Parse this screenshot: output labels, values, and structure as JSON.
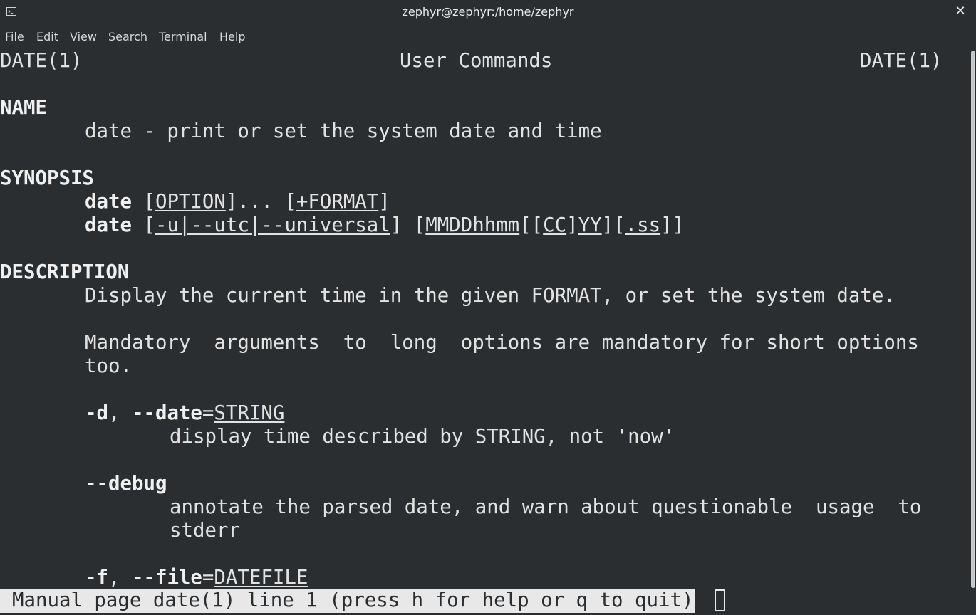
{
  "window": {
    "title": "zephyr@zephyr:/home/zephyr",
    "close_glyph": "✕",
    "app_icon": "terminal-icon"
  },
  "menubar": {
    "items": [
      "File",
      "Edit",
      "View",
      "Search",
      "Terminal",
      "Help"
    ]
  },
  "man": {
    "header_left": "DATE(1)",
    "header_center": "User Commands",
    "header_right": "DATE(1)",
    "name_heading": "NAME",
    "name_text": "date - print or set the system date and time",
    "synopsis_heading": "SYNOPSIS",
    "synopsis_cmd": "date",
    "synopsis1_open": " [",
    "synopsis1_option": "OPTION",
    "synopsis1_mid": "]... [",
    "synopsis1_format": "+FORMAT",
    "synopsis1_close": "]",
    "synopsis2_open": " [",
    "synopsis2_u": "-u|--utc|--universal",
    "synopsis2_mid1": "] [",
    "synopsis2_mmdd": "MMDDhhmm",
    "synopsis2_b1": "[[",
    "synopsis2_cc": "CC",
    "synopsis2_b2": "]",
    "synopsis2_yy": "YY",
    "synopsis2_b3": "][",
    "synopsis2_ss": ".ss",
    "synopsis2_close": "]]",
    "description_heading": "DESCRIPTION",
    "desc_line1": "Display the current time in the given FORMAT, or set the system date.",
    "desc_line2": "Mandatory  arguments  to  long  options are mandatory for short options",
    "desc_line3": "too.",
    "opt_d_short": "-d",
    "opt_d_sep": ", ",
    "opt_d_long": "--date",
    "opt_d_eq": "=",
    "opt_d_arg": "STRING",
    "opt_d_desc": "display time described by STRING, not 'now'",
    "opt_debug": "--debug",
    "opt_debug_desc1": "annotate the parsed date, and warn about questionable  usage  to",
    "opt_debug_desc2": "stderr",
    "opt_f_short": "-f",
    "opt_f_sep": ", ",
    "opt_f_long": "--file",
    "opt_f_eq": "=",
    "opt_f_arg": "DATEFILE"
  },
  "status": {
    "text": "Manual page date(1) line 1 (press h for help or q to quit)"
  }
}
